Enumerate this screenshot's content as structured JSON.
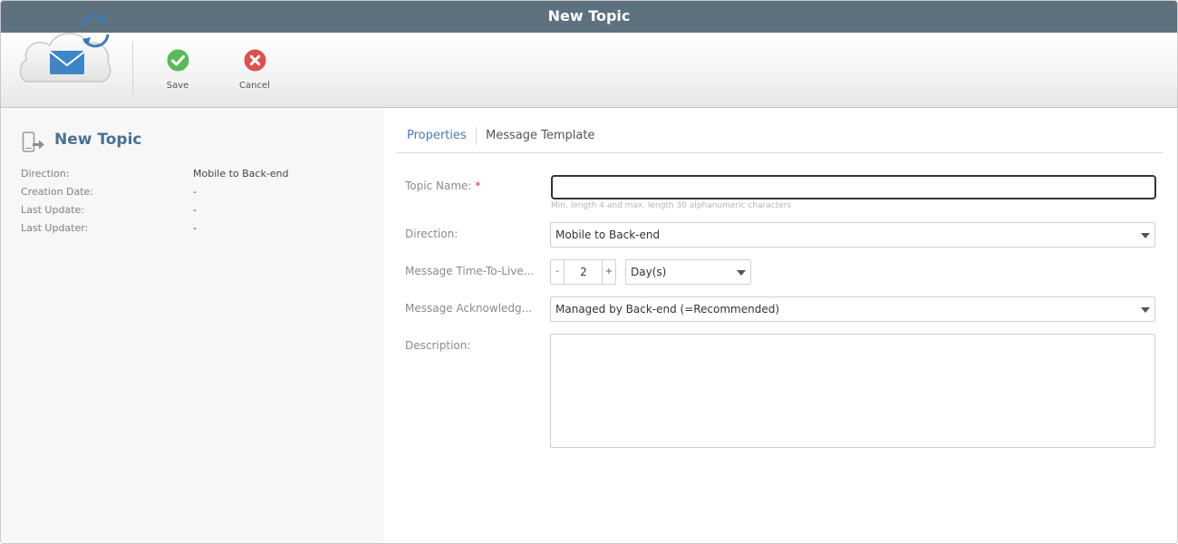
{
  "window": {
    "title": "New Topic"
  },
  "toolbar": {
    "save_label": "Save",
    "cancel_label": "Cancel"
  },
  "left_panel": {
    "title": "New Topic",
    "properties": [
      {
        "key": "Direction:",
        "value": "Mobile to Back-end"
      },
      {
        "key": "Creation Date:",
        "value": "-"
      },
      {
        "key": "Last Update:",
        "value": "-"
      },
      {
        "key": "Last Updater:",
        "value": "-"
      }
    ]
  },
  "tabs": [
    {
      "label": "Properties",
      "active": true
    },
    {
      "label": "Message Template",
      "active": false
    }
  ],
  "form": {
    "topic_name": {
      "label": "Topic Name:",
      "required_mark": "*",
      "value": "",
      "hint": "Min. length 4 and max. length 30 alphanumeric characters"
    },
    "direction": {
      "label": "Direction:",
      "value": "Mobile to Back-end"
    },
    "ttl": {
      "label": "Message Time-To-Live...",
      "minus": "-",
      "value": "2",
      "plus": "+",
      "unit": "Day(s)"
    },
    "ack": {
      "label": "Message Acknowledg...",
      "value": "Managed by Back-end (=Recommended)"
    },
    "description": {
      "label": "Description:",
      "value": ""
    }
  },
  "colors": {
    "titlebar": "#5e717f",
    "accent": "#4a7ab0",
    "save": "#5cb85c",
    "cancel": "#d9534f"
  },
  "icons": {
    "logo": "cloud-envelope-sync-icon",
    "save": "check-circle-icon",
    "cancel": "x-circle-icon",
    "topic": "mobile-arrow-icon"
  }
}
